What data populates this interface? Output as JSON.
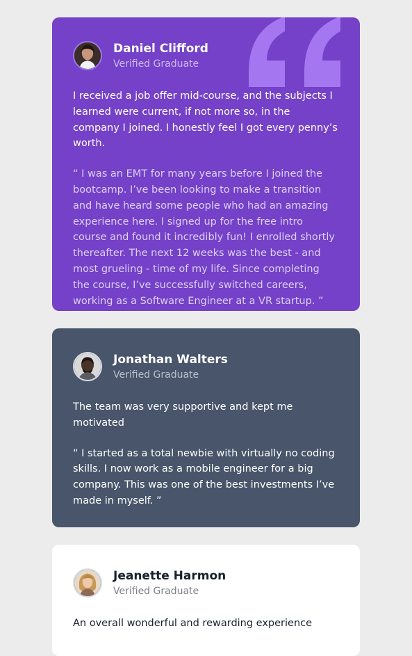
{
  "colors": {
    "background": "#ececec",
    "purple_card": "#7541c8",
    "slate_card": "#48556a",
    "white_card": "#ffffff",
    "quote_decoration": "#a477f1"
  },
  "testimonials": [
    {
      "name": "Daniel Clifford",
      "role": "Verified Graduate",
      "summary": "I received a job offer mid-course, and the subjects I learned were current, if not more so, in the company I joined. I honestly feel I got every penny’s worth.",
      "quote": "“ I was an EMT for many years before I joined the bootcamp. I’ve been looking to make a transition and have heard some people who had an amazing experience here. I signed up for the free intro course and found it incredibly fun! I enrolled shortly thereafter. The next 12 weeks was the best - and most grueling - time of my life. Since completing the course, I’ve successfully switched careers, working as a Software Engineer at a VR startup. ”",
      "decoration_icon": "quotation-mark-icon"
    },
    {
      "name": "Jonathan Walters",
      "role": "Verified Graduate",
      "summary": "The team was very supportive and kept me motivated",
      "quote": "“ I started as a total newbie with virtually no coding skills. I now work as a mobile engineer for a big company. This was one of the best investments I’ve made in myself. ”"
    },
    {
      "name": "Jeanette Harmon",
      "role": "Verified Graduate",
      "summary": "An overall wonderful and rewarding experience"
    }
  ]
}
